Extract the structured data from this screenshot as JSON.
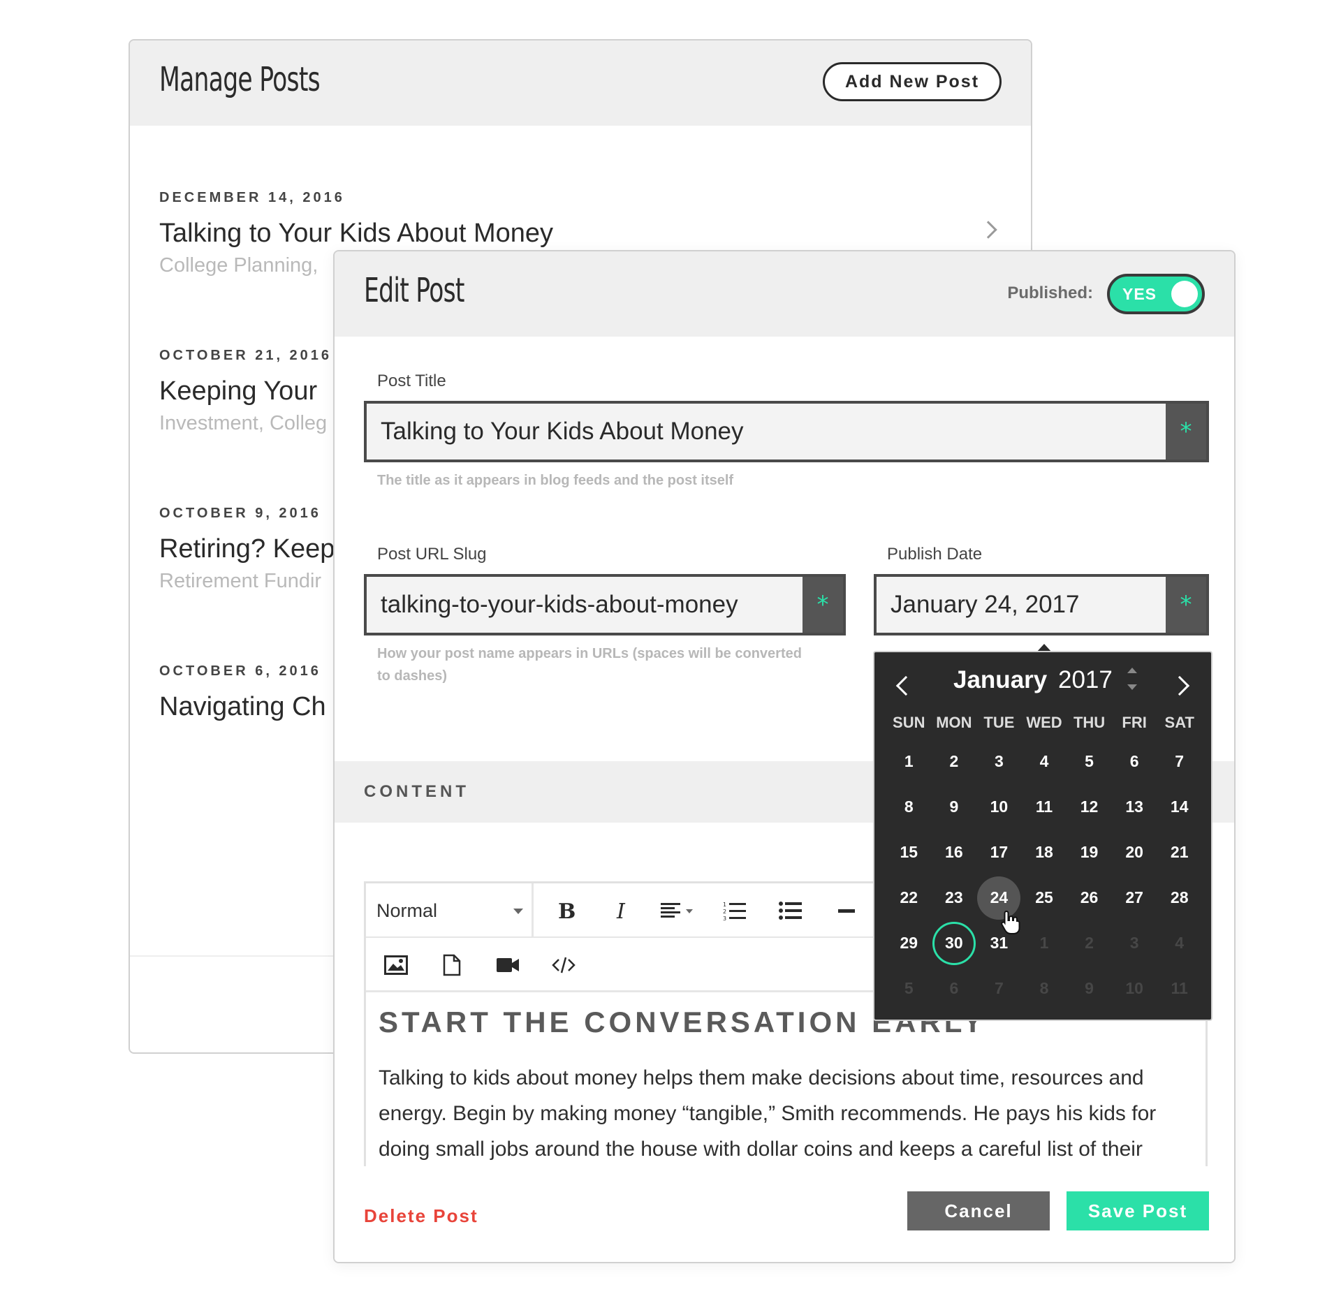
{
  "manage_posts": {
    "title": "Manage Posts",
    "add_button": "Add New Post",
    "posts": [
      {
        "date": "DECEMBER 14, 2016",
        "title": "Talking to Your Kids About Money",
        "categories": "College Planning,"
      },
      {
        "date": "OCTOBER 21, 2016",
        "title": "Keeping Your",
        "categories": "Investment, Colleg"
      },
      {
        "date": "OCTOBER 9, 2016",
        "title": "Retiring? Keep",
        "categories": "Retirement Fundir"
      },
      {
        "date": "OCTOBER 6, 2016",
        "title": "Navigating Ch",
        "categories": ""
      }
    ]
  },
  "edit_post": {
    "title": "Edit Post",
    "published_label": "Published:",
    "published_toggle": "YES",
    "post_title": {
      "label": "Post Title",
      "value": "Talking to Your Kids About Money",
      "help": "The title as it appears in blog feeds and the post itself"
    },
    "slug": {
      "label": "Post URL Slug",
      "value": "talking-to-your-kids-about-money",
      "help_line1": "How your post name appears in URLs (spaces will be converted",
      "help_line2": "to dashes)"
    },
    "publish_date": {
      "label": "Publish Date",
      "value": "January 24, 2017"
    },
    "required_marker": "*",
    "content_label": "CONTENT",
    "editor": {
      "format_select": "Normal",
      "heading": "START THE CONVERSATION EARLY",
      "body": "Talking to kids about money helps them make decisions about time, resources and energy. Begin by making money “tangible,” Smith recommends. He pays his kids for doing small jobs around the house with dollar coins and keeps a careful list of their"
    },
    "delete_label": "Delete Post",
    "cancel_label": "Cancel",
    "save_label": "Save Post"
  },
  "datepicker": {
    "month": "January",
    "year": "2017",
    "weekdays": [
      "SUN",
      "MON",
      "TUE",
      "WED",
      "THU",
      "FRI",
      "SAT"
    ],
    "weeks": [
      [
        "1",
        "2",
        "3",
        "4",
        "5",
        "6",
        "7"
      ],
      [
        "8",
        "9",
        "10",
        "11",
        "12",
        "13",
        "14"
      ],
      [
        "15",
        "16",
        "17",
        "18",
        "19",
        "20",
        "21"
      ],
      [
        "22",
        "23",
        "24",
        "25",
        "26",
        "27",
        "28"
      ],
      [
        "29",
        "30",
        "31",
        "1",
        "2",
        "3",
        "4"
      ],
      [
        "5",
        "6",
        "7",
        "8",
        "9",
        "10",
        "11"
      ]
    ],
    "selected_day": "24",
    "today_day": "30"
  },
  "colors": {
    "accent": "#2be0a8",
    "danger": "#e8443a",
    "dark": "#2b2b2b"
  }
}
